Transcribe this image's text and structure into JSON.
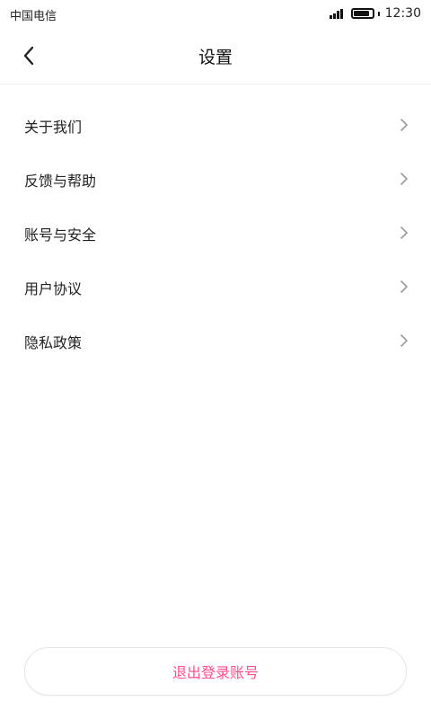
{
  "status_bar": {
    "carrier": "中国电信",
    "time": "12:30",
    "battery_level": 0.9
  },
  "nav": {
    "title": "设置",
    "back_icon": "chevron-left-icon"
  },
  "menu": {
    "items": [
      {
        "label": "关于我们",
        "icon": "chevron-right-icon"
      },
      {
        "label": "反馈与帮助",
        "icon": "chevron-right-icon"
      },
      {
        "label": "账号与安全",
        "icon": "chevron-right-icon"
      },
      {
        "label": "用户协议",
        "icon": "chevron-right-icon"
      },
      {
        "label": "隐私政策",
        "icon": "chevron-right-icon"
      }
    ]
  },
  "logout": {
    "label": "退出登录账号"
  },
  "colors": {
    "accent": "#ff4f8b",
    "text": "#222222",
    "chevron": "#9a9a9a",
    "divider": "#f0f0f0"
  }
}
